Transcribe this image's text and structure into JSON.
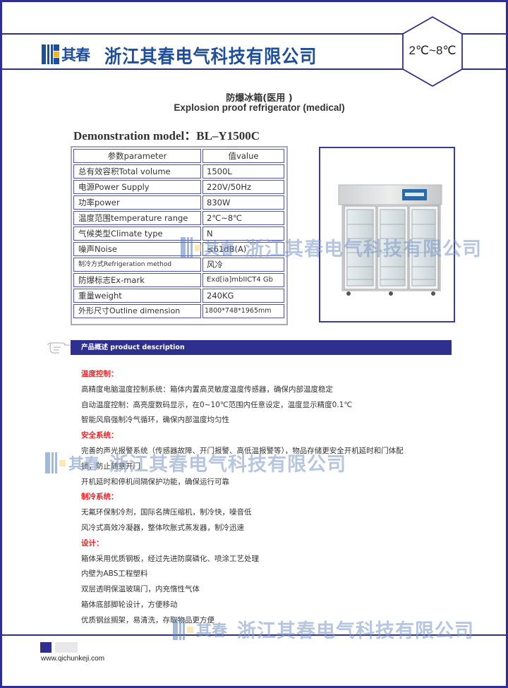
{
  "header": {
    "logo_brand": "其春",
    "company_name": "浙江其春电气科技有限公司",
    "temperature_badge": "2℃~8℃"
  },
  "product": {
    "title_cn": "防爆冰箱(医用 )",
    "title_en": "Explosion proof refrigerator (medical)",
    "model_line": "Demonstration model：BL–Y1500C",
    "image_alt": "three-door glass refrigerator"
  },
  "specs": {
    "headers": [
      "参数parameter",
      "值value"
    ],
    "rows": [
      {
        "param": "总有效容积Total volume",
        "value": "1500L"
      },
      {
        "param": "电源Power Supply",
        "value": "220V/50Hz"
      },
      {
        "param": "功率power",
        "value": "830W"
      },
      {
        "param": "温度范围temperature range",
        "value": "2℃~8℃"
      },
      {
        "param": "气候类型Climate type",
        "value": "N"
      },
      {
        "param": "噪声Noise",
        "value": "≤61dB(A)"
      },
      {
        "param": "制冷方式Refrigeration method",
        "value": "风冷"
      },
      {
        "param": "防爆标志Ex-mark",
        "value": "Exd[ia]mbIICT4 Gb"
      },
      {
        "param": "重量weight",
        "value": "240KG"
      },
      {
        "param": "外形尺寸Outline dimension",
        "value": "1800*748*1965mm"
      }
    ]
  },
  "description": {
    "bar_label": "产品概述  product description",
    "icon": "pointing-hand-icon",
    "sections": [
      {
        "heading": "温度控制：",
        "lines": [
          "高精度电脑温度控制系统：箱体内置高灵敏度温度传感器，确保内部温度稳定",
          "自动温度控制：高亮度数码显示，在0~10℃范围内任意设定，温度显示精度0.1℃",
          "智能风扇强制冷气循环，确保内部温度均匀性"
        ]
      },
      {
        "heading": "安全系统：",
        "lines": [
          "完善的声光报警系统（传感器故障、开门报警、高低温报警等），物品存储更安全开机延时和门体配",
          "锁，防止随意开门",
          "开机延时和停机间隔保护功能，确保运行可靠"
        ]
      },
      {
        "heading": "制冷系统：",
        "lines": [
          "无氟环保制冷剂，国际名牌压缩机，制冷快，噪音低",
          "风冷式高效冷凝器，整体吹胀式蒸发器，制冷迅速"
        ]
      },
      {
        "heading": "设计：",
        "lines": [
          "箱体采用优质钢板，经过先进防腐磷化、喷涂工艺处理",
          "内壁为ABS工程塑料",
          "双层透明保温玻璃门，内充惰性气体",
          "箱体底部脚轮设计，方便移动",
          "优质钢丝搁架，易清洗，存取物品更方便"
        ]
      }
    ]
  },
  "watermark": {
    "brand": "其春",
    "name": "浙江其春电气科技有限公司"
  },
  "footer": {
    "url": "www.qichunkeji.com"
  },
  "colors": {
    "brand_navy": "#2e2f8e",
    "logo_blue": "#1f4e9a",
    "logo_yellow": "#f2b51c",
    "heading_red": "#e8262a"
  }
}
